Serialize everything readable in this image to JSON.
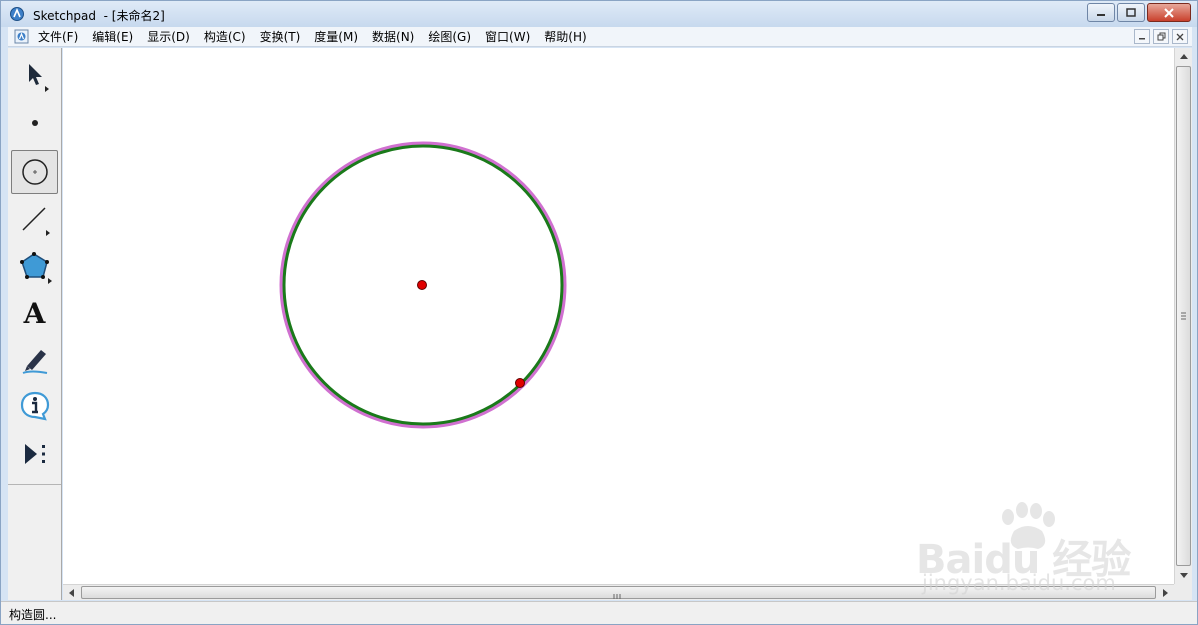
{
  "window": {
    "title": "Sketchpad  - [未命名2]",
    "controls": [
      "minimize",
      "maximize",
      "close"
    ]
  },
  "menubar": {
    "items": [
      {
        "label": "文件(F)"
      },
      {
        "label": "编辑(E)"
      },
      {
        "label": "显示(D)"
      },
      {
        "label": "构造(C)"
      },
      {
        "label": "变换(T)"
      },
      {
        "label": "度量(M)"
      },
      {
        "label": "数据(N)"
      },
      {
        "label": "绘图(G)"
      },
      {
        "label": "窗口(W)"
      },
      {
        "label": "帮助(H)"
      }
    ]
  },
  "toolbox": {
    "tools": [
      {
        "icon": "arrow-select-icon",
        "selected": false
      },
      {
        "icon": "point-icon",
        "selected": false
      },
      {
        "icon": "compass-circle-icon",
        "selected": true
      },
      {
        "icon": "straightedge-icon",
        "selected": false
      },
      {
        "icon": "polygon-icon",
        "selected": false
      },
      {
        "icon": "text-icon",
        "label": "A",
        "selected": false
      },
      {
        "icon": "marker-pen-icon",
        "selected": false
      },
      {
        "icon": "information-icon",
        "selected": false
      },
      {
        "icon": "custom-tool-icon",
        "selected": false
      }
    ]
  },
  "canvas": {
    "circle": {
      "stroke": "#1a7a1a",
      "highlight": "#d070d0"
    },
    "points": [
      {
        "role": "center",
        "color": "#e00000"
      },
      {
        "role": "radius-point",
        "color": "#e00000"
      }
    ]
  },
  "statusbar": {
    "text": "构造圆..."
  },
  "watermark": {
    "brand": "Baidu 经验",
    "url": "jingyan.baidu.com"
  }
}
